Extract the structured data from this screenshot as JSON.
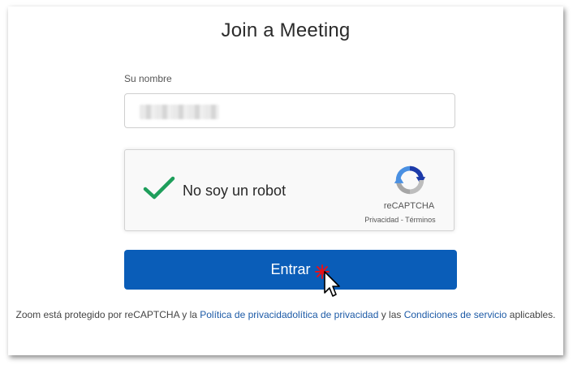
{
  "page": {
    "title": "Join a Meeting",
    "name_label": "Su nombre",
    "name_value": "",
    "captcha": {
      "label": "No soy un robot",
      "brand": "reCAPTCHA",
      "privacy_link": "Privacidad",
      "separator": " - ",
      "terms_link": "Términos",
      "checked": true
    },
    "enter_button": "Entrar",
    "footer": {
      "prefix": "Zoom está protegido por reCAPTCHA y la ",
      "privacy_link": "Política de privacidadolítica de privacidad",
      "middle": " y las ",
      "terms_link": "Condiciones de servicio",
      "suffix": " aplicables."
    }
  },
  "colors": {
    "button": "#0a5db8",
    "link": "#1c5aa6",
    "check": "#1e9e5b",
    "cursor_sparkle": "#e3121b"
  },
  "icons": [
    "checkmark-icon",
    "recaptcha-logo-icon",
    "mouse-pointer-icon"
  ]
}
